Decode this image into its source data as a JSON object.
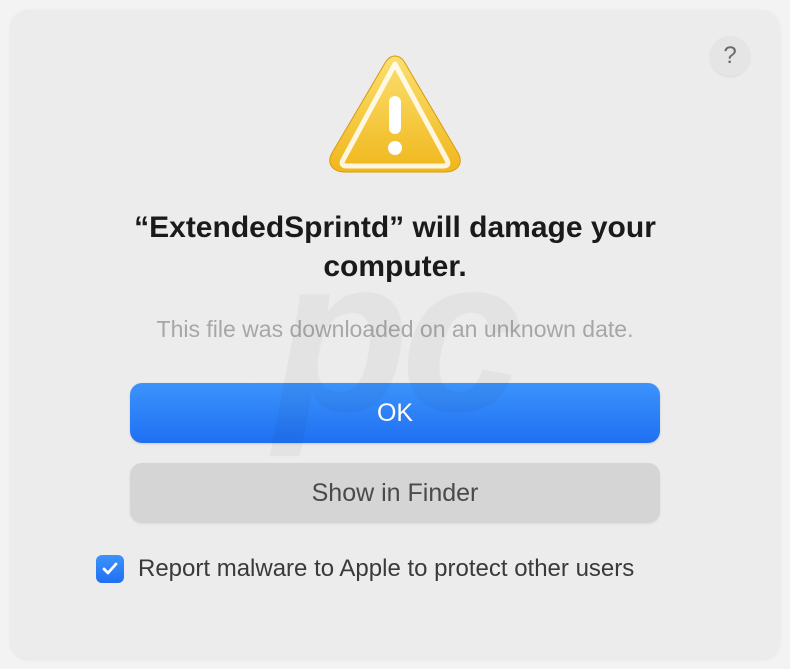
{
  "help": {
    "label": "?"
  },
  "heading": "“ExtendedSprintd” will damage your computer.",
  "subtext": "This file was downloaded on an unknown date.",
  "buttons": {
    "primary": "OK",
    "secondary": "Show in Finder"
  },
  "checkbox": {
    "checked": true,
    "label": "Report malware to Apple to protect other users"
  },
  "icons": {
    "warning": "warning-triangle-icon",
    "help": "help-icon",
    "check": "check-icon"
  }
}
